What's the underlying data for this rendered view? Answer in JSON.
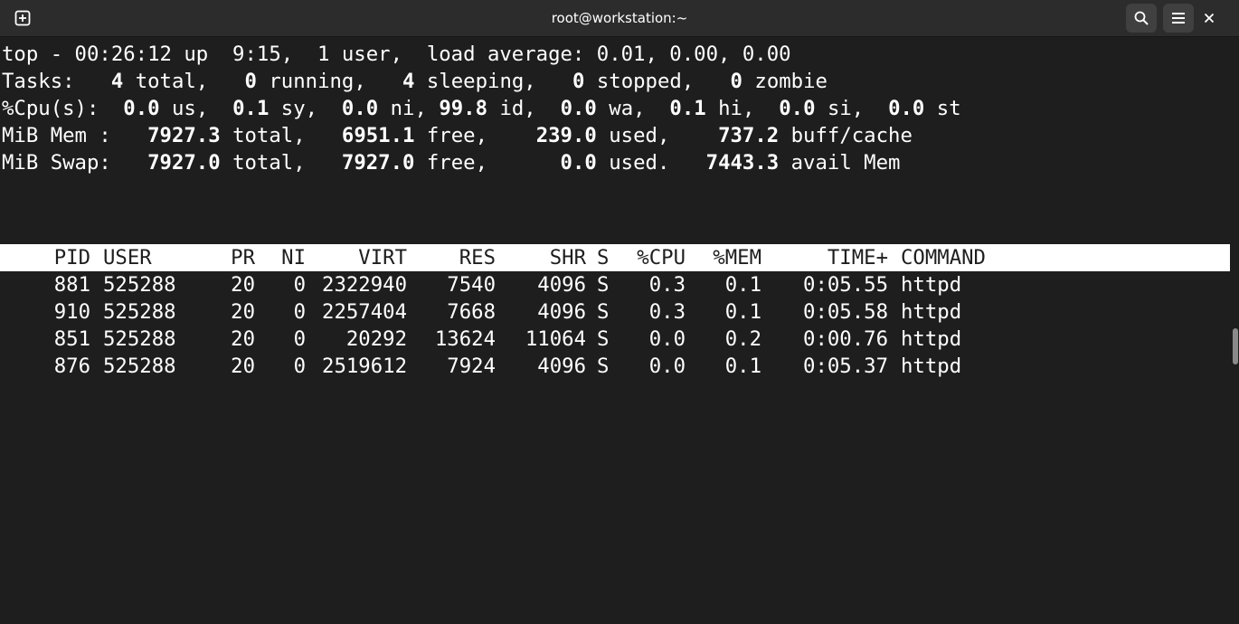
{
  "window": {
    "title": "root@workstation:~",
    "icons": [
      "new-tab-icon",
      "search-icon",
      "hamburger-menu-icon",
      "close-icon"
    ]
  },
  "summary": {
    "line1": "top - 00:26:12 up  9:15,  1 user,  load average: 0.01, 0.00, 0.00",
    "tasks": {
      "label": "Tasks:",
      "total": "4",
      "running": "0",
      "sleeping": "4",
      "stopped": "0",
      "zombie": "0"
    },
    "cpu": {
      "label": "%Cpu(s):",
      "us": "0.0",
      "sy": "0.1",
      "ni": "0.0",
      "id": "99.8",
      "wa": "0.0",
      "hi": "0.1",
      "si": "0.0",
      "st": "0.0"
    },
    "mem": {
      "label": "MiB Mem :",
      "total": "7927.3",
      "free": "6951.1",
      "used": "239.0",
      "buff_cache": "737.2"
    },
    "swap": {
      "label": "MiB Swap:",
      "total": "7927.0",
      "free": "7927.0",
      "used": "0.0",
      "avail_mem": "7443.3"
    }
  },
  "columns": [
    "PID",
    "USER",
    "PR",
    "NI",
    "VIRT",
    "RES",
    "SHR",
    "S",
    "%CPU",
    "%MEM",
    "TIME+",
    "COMMAND"
  ],
  "processes": [
    {
      "pid": "881",
      "user": "525288",
      "pr": "20",
      "ni": "0",
      "virt": "2322940",
      "res": "7540",
      "shr": "4096",
      "s": "S",
      "cpu": "0.3",
      "mem": "0.1",
      "time": "0:05.55",
      "command": "httpd"
    },
    {
      "pid": "910",
      "user": "525288",
      "pr": "20",
      "ni": "0",
      "virt": "2257404",
      "res": "7668",
      "shr": "4096",
      "s": "S",
      "cpu": "0.3",
      "mem": "0.1",
      "time": "0:05.58",
      "command": "httpd"
    },
    {
      "pid": "851",
      "user": "525288",
      "pr": "20",
      "ni": "0",
      "virt": "20292",
      "res": "13624",
      "shr": "11064",
      "s": "S",
      "cpu": "0.0",
      "mem": "0.2",
      "time": "0:00.76",
      "command": "httpd"
    },
    {
      "pid": "876",
      "user": "525288",
      "pr": "20",
      "ni": "0",
      "virt": "2519612",
      "res": "7924",
      "shr": "4096",
      "s": "S",
      "cpu": "0.0",
      "mem": "0.1",
      "time": "0:05.37",
      "command": "httpd"
    }
  ]
}
